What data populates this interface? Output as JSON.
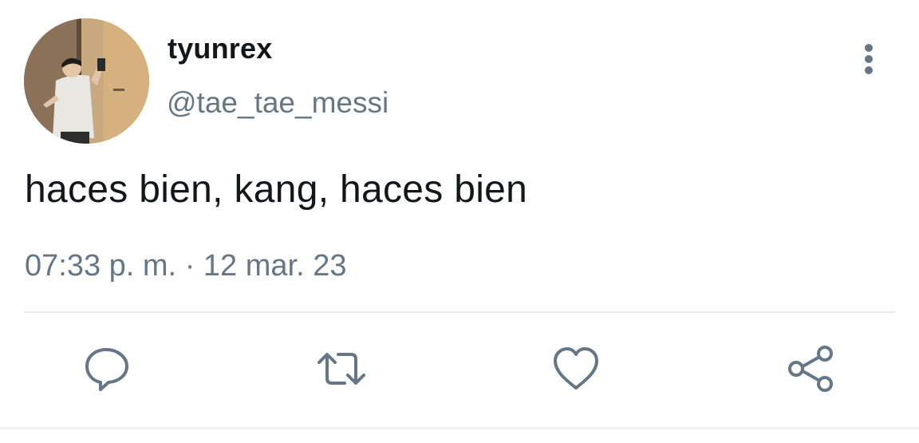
{
  "tweet": {
    "display_name": "tyunrex",
    "handle": "@tae_tae_messi",
    "text": "haces bien, kang, haces bien",
    "time": "07:33 p. m.",
    "separator": "·",
    "date": "12 mar. 23"
  },
  "actions": {
    "reply_icon": "reply-icon",
    "retweet_icon": "retweet-icon",
    "like_icon": "heart-icon",
    "share_icon": "share-icon",
    "more_icon": "more-vertical-icon"
  },
  "colors": {
    "text_primary": "#14171a",
    "text_secondary": "#657786",
    "icon": "#657786",
    "divider": "#e6ecf0"
  }
}
